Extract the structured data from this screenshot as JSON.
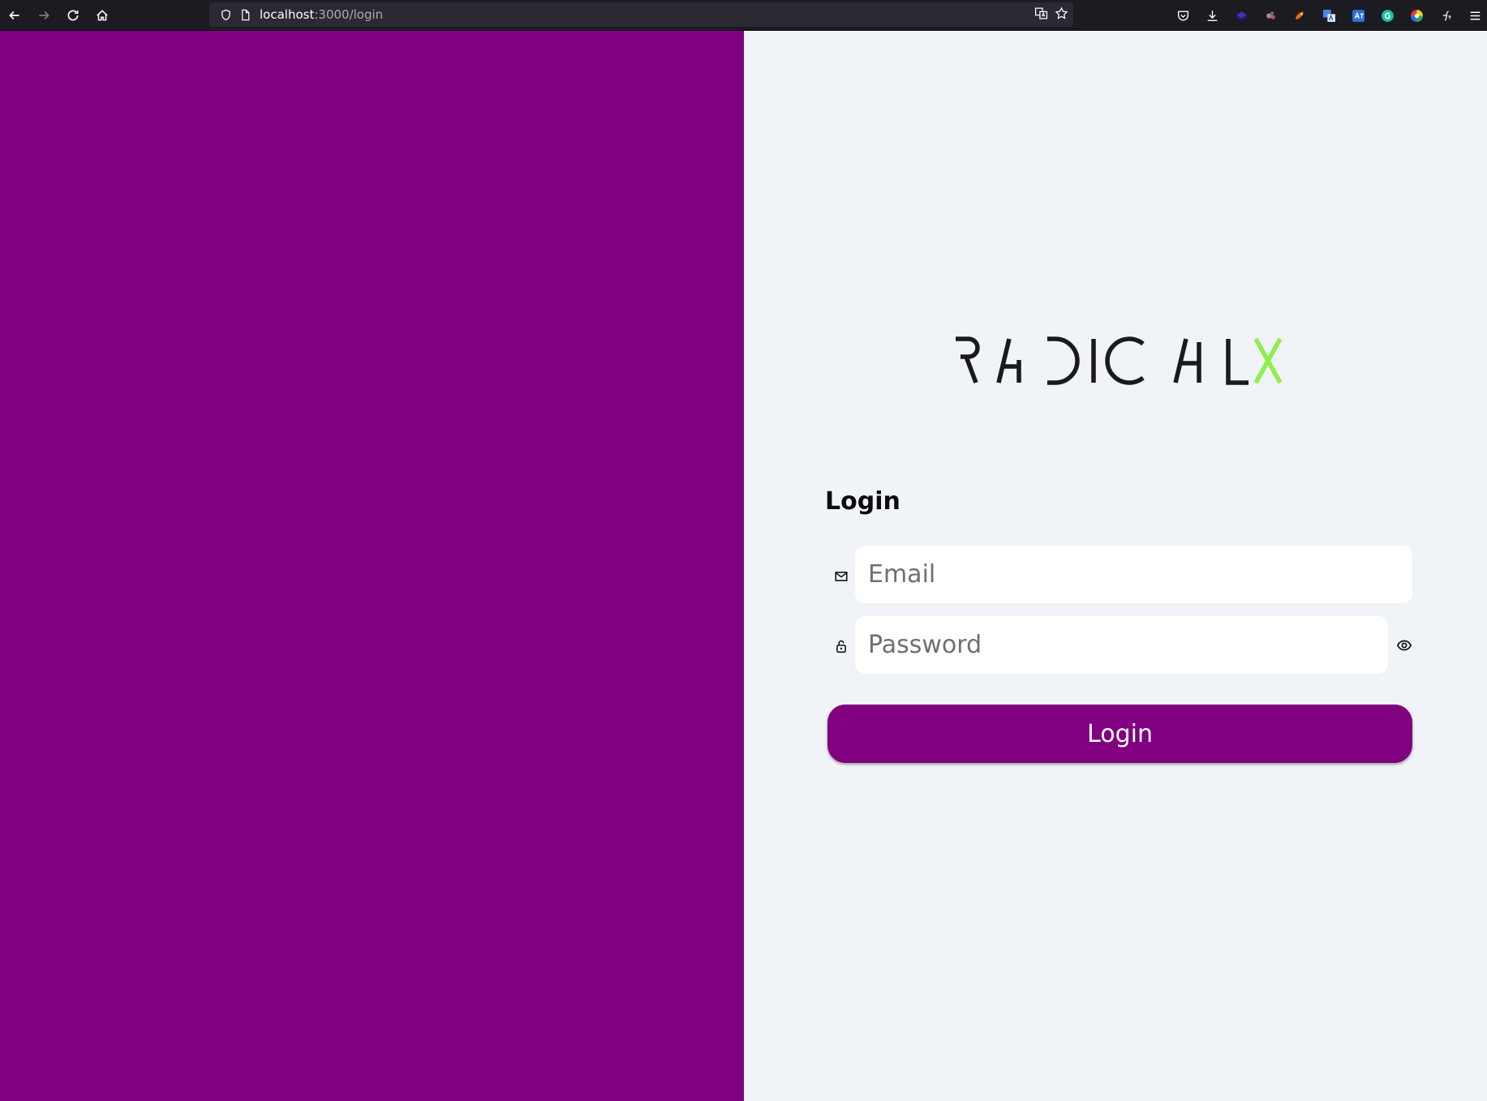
{
  "browser": {
    "url_host": "localhost",
    "url_path": ":3000/login",
    "icons": {
      "back": "back-arrow-icon",
      "forward": "forward-arrow-icon",
      "reload": "reload-icon",
      "home": "home-icon",
      "shield": "shield-icon",
      "page": "page-icon",
      "translate": "translate-icon",
      "bookmark": "star-icon"
    },
    "extensions": [
      "pocket-icon",
      "download-icon",
      "extension-1-icon",
      "extension-2-icon",
      "extension-3-icon",
      "translate-ext-icon",
      "translate-ext-2-icon",
      "grammarly-icon",
      "color-picker-icon",
      "formula-icon",
      "menu-icon"
    ]
  },
  "brand": {
    "logo_text_main": "RADICAL",
    "logo_text_accent": "X",
    "logo_color": "#1a1a1a",
    "accent_color": "#8ef04a"
  },
  "left_panel": {
    "color": "#800080"
  },
  "form": {
    "title": "Login",
    "email": {
      "icon": "mail-icon",
      "placeholder": "Email",
      "value": ""
    },
    "password": {
      "icon": "lock-icon",
      "placeholder": "Password",
      "value": "",
      "toggle_icon": "eye-icon"
    },
    "submit_label": "Login",
    "primary_color": "#800080"
  }
}
